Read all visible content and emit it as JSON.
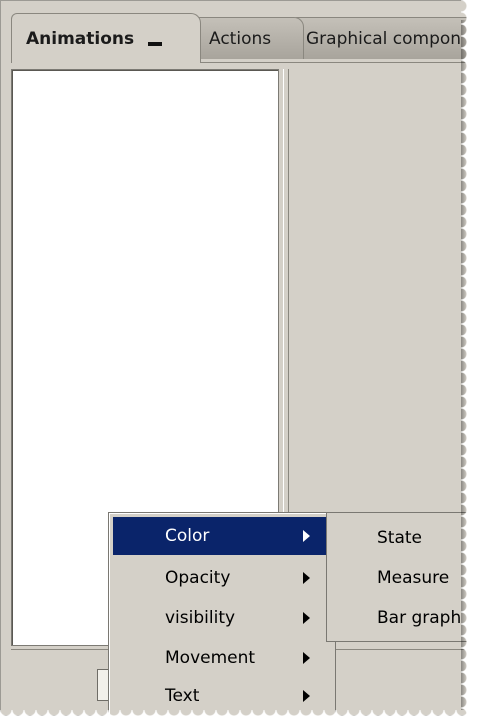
{
  "tabs": [
    {
      "label": "Animations",
      "active": true
    },
    {
      "label": "Actions",
      "active": false
    },
    {
      "label": "Graphical compon",
      "active": false
    }
  ],
  "context_menu": {
    "items": [
      {
        "label": "Color",
        "highlighted": true,
        "has_submenu": true
      },
      {
        "label": "Opacity",
        "highlighted": false,
        "has_submenu": true
      },
      {
        "label": "visibility",
        "highlighted": false,
        "has_submenu": true
      },
      {
        "label": "Movement",
        "highlighted": false,
        "has_submenu": true
      },
      {
        "label": "Text",
        "highlighted": false,
        "has_submenu": true
      }
    ]
  },
  "submenu": {
    "items": [
      {
        "label": "State"
      },
      {
        "label": "Measure"
      },
      {
        "label": "Bar graph"
      }
    ]
  },
  "colors": {
    "window_bg": "#d4d0c8",
    "highlight": "#0a246a",
    "panel_bg": "#ffffff"
  },
  "icons": [
    "minimize-icon",
    "submenu-arrow-icon",
    "document-icon"
  ]
}
